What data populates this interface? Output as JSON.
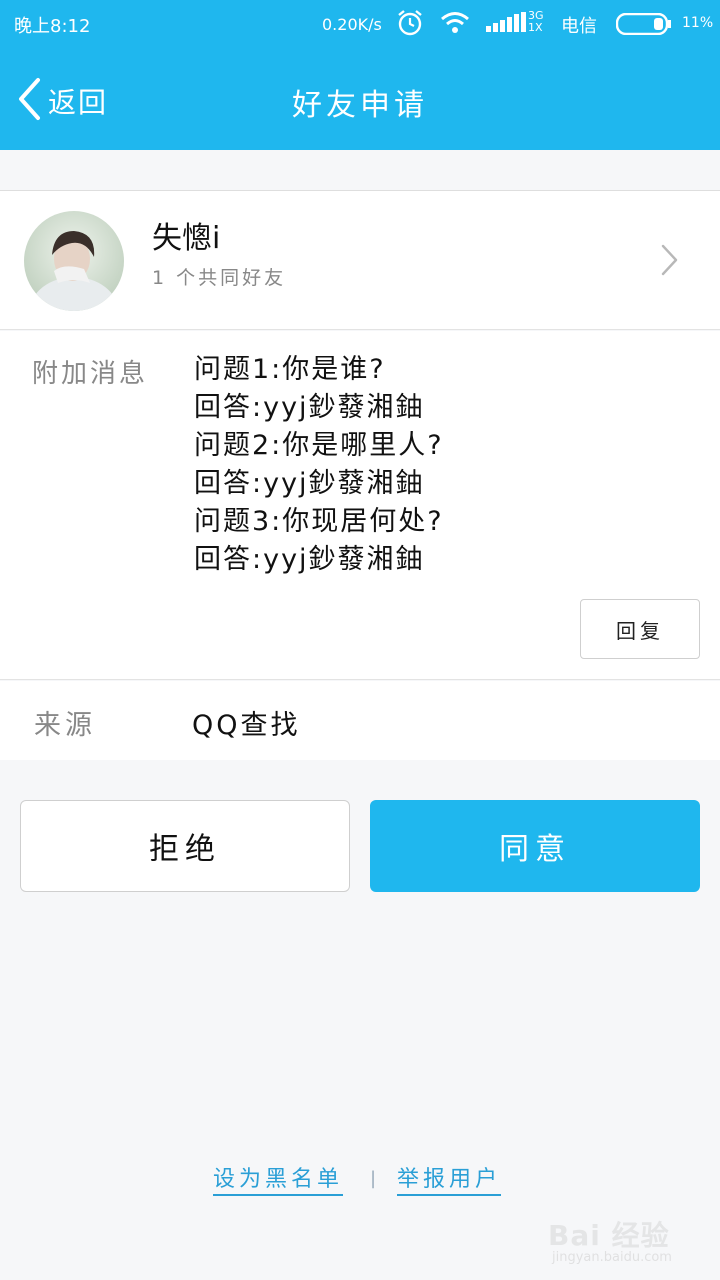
{
  "status_bar": {
    "time": "晚上8:12",
    "net_speed": "0.20K/s",
    "net_type_top": "3G",
    "net_type_bottom": "1X",
    "carrier": "电信",
    "battery": "11%"
  },
  "header": {
    "back_label": "返回",
    "title": "好友申请"
  },
  "user": {
    "name": "失憁i",
    "mutual_friends": "1 个共同好友"
  },
  "message": {
    "label": "附加消息",
    "lines": [
      "问题1:你是谁?",
      "回答:yyj鈔蕟湘鈾",
      "问题2:你是哪里人?",
      "回答:yyj鈔蕟湘鈾",
      "问题3:你现居何处?",
      "回答:yyj鈔蕟湘鈾"
    ],
    "reply_label": "回复"
  },
  "source": {
    "label": "来源",
    "value": "QQ查找"
  },
  "actions": {
    "reject_label": "拒绝",
    "accept_label": "同意"
  },
  "footer": {
    "blacklist_label": "设为黑名单",
    "separator": "|",
    "report_label": "举报用户"
  },
  "watermark": {
    "logo": "Bai 经验",
    "url": "jingyan.baidu.com"
  },
  "colors": {
    "accent": "#1fb7ee",
    "link": "#2a9fd6",
    "background": "#f6f7f9"
  }
}
